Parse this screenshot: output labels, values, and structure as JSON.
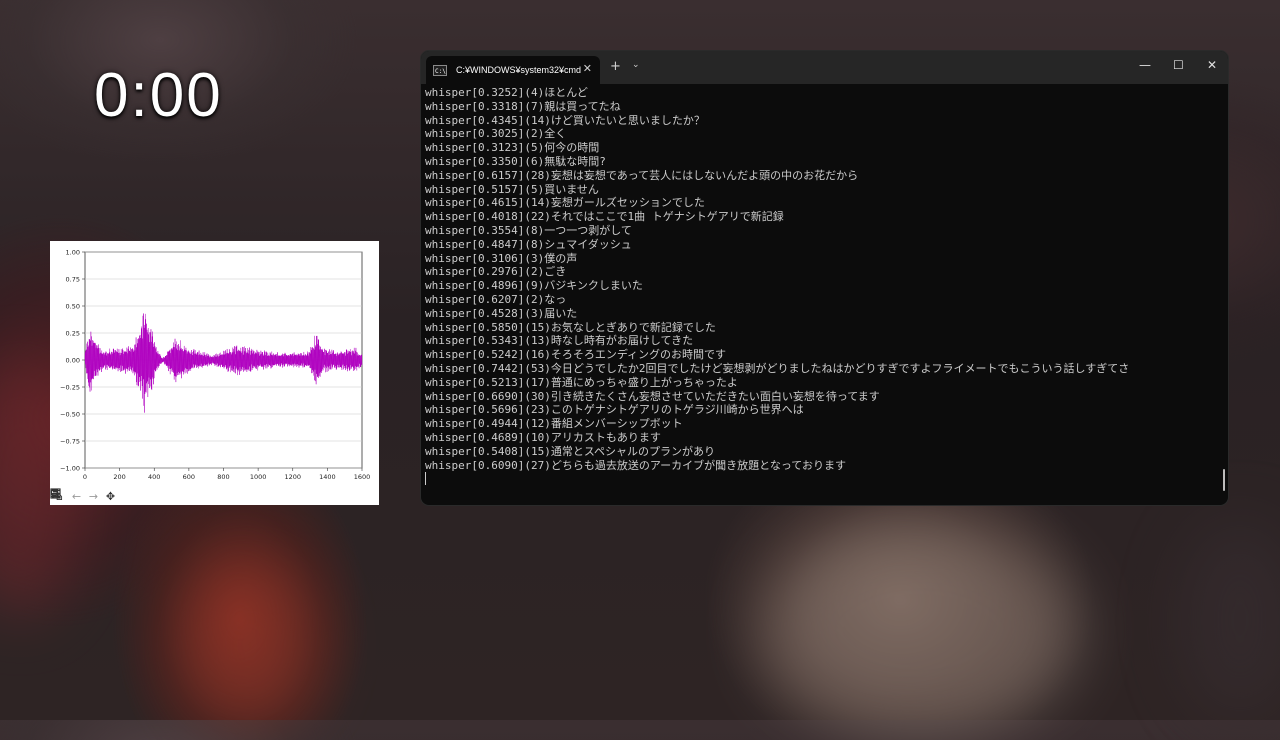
{
  "timer": "0:00",
  "terminal": {
    "tab_title": "C:¥WINDOWS¥system32¥cmd",
    "tab_icon_text": "C:\\",
    "new_tab_label": "+",
    "dropdown_label": "⌄",
    "minimize_label": "—",
    "maximize_label": "☐",
    "close_label": "✕",
    "tab_close_label": "✕",
    "lines": [
      "whisper[0.3252](4)ほとんど",
      "whisper[0.3318](7)親は買ってたね",
      "whisper[0.4345](14)けど買いたいと思いましたか？",
      "whisper[0.3025](2)全く",
      "whisper[0.3123](5)何今の時間",
      "whisper[0.3350](6)無駄な時間?",
      "whisper[0.6157](28)妄想は妄想であって芸人にはしないんだよ頭の中のお花だから",
      "whisper[0.5157](5)買いません",
      "whisper[0.4615](14)妄想ガールズセッションでした",
      "whisper[0.4018](22)それではここで1曲 トゲナシトゲアリで新記録",
      "whisper[0.3554](8)一つ一つ剥がして",
      "whisper[0.4847](8)シュマイダッシュ",
      "whisper[0.3106](3)僕の声",
      "whisper[0.2976](2)ごき",
      "whisper[0.4896](9)バジキンクしまいた",
      "whisper[0.6207](2)なっ",
      "whisper[0.4528](3)届いた",
      "whisper[0.5850](15)お気なしとぎありで新記録でした",
      "whisper[0.5343](13)時なし時有がお届けしてきた",
      "whisper[0.5242](16)そろそろエンディングのお時間です",
      "whisper[0.7442](53)今日どうでしたか2回目でしたけど妄想剥がどりましたねはかどりすぎですよフライメートでもこういう話しすぎてさ",
      "whisper[0.5213](17)普通にめっちゃ盛り上がっちゃったよ",
      "whisper[0.6690](30)引き続きたくさん妄想させていただきたい面白い妄想を待ってます",
      "whisper[0.5696](23)このトゲナシトゲアリのトゲラジ川崎から世界へは",
      "whisper[0.4944](12)番組メンバーシップボット",
      "whisper[0.4689](10)アリカストもあります",
      "whisper[0.5408](15)通常とスペシャルのプランがあり",
      "whisper[0.6090](27)どちらも過去放送のアーカイブが聞き放題となっております"
    ]
  },
  "plot": {
    "chart_data": {
      "type": "line",
      "title": "",
      "xlabel": "",
      "ylabel": "",
      "xlim": [
        0,
        1600
      ],
      "ylim": [
        -1.0,
        1.0
      ],
      "x_ticks": [
        "0",
        "200",
        "400",
        "600",
        "800",
        "1000",
        "1200",
        "1400",
        "1600"
      ],
      "y_ticks": [
        "1.00",
        "0.75",
        "0.50",
        "0.25",
        "0.00",
        "−0.25",
        "−0.50",
        "−0.75",
        "−1.00"
      ],
      "grid": "horizontal",
      "color": "#b000c0",
      "envelope": [
        {
          "x": 0,
          "amp": 0.08
        },
        {
          "x": 30,
          "amp": 0.38
        },
        {
          "x": 60,
          "amp": 0.2
        },
        {
          "x": 100,
          "amp": 0.1
        },
        {
          "x": 200,
          "amp": 0.12
        },
        {
          "x": 280,
          "amp": 0.15
        },
        {
          "x": 320,
          "amp": 0.35
        },
        {
          "x": 345,
          "amp": 0.53
        },
        {
          "x": 380,
          "amp": 0.35
        },
        {
          "x": 420,
          "amp": 0.1
        },
        {
          "x": 450,
          "amp": 0.02
        },
        {
          "x": 530,
          "amp": 0.24
        },
        {
          "x": 570,
          "amp": 0.15
        },
        {
          "x": 640,
          "amp": 0.1
        },
        {
          "x": 740,
          "amp": 0.05
        },
        {
          "x": 880,
          "amp": 0.15
        },
        {
          "x": 1000,
          "amp": 0.1
        },
        {
          "x": 1120,
          "amp": 0.07
        },
        {
          "x": 1290,
          "amp": 0.08
        },
        {
          "x": 1340,
          "amp": 0.28
        },
        {
          "x": 1380,
          "amp": 0.12
        },
        {
          "x": 1460,
          "amp": 0.09
        },
        {
          "x": 1560,
          "amp": 0.12
        },
        {
          "x": 1600,
          "amp": 0.06
        }
      ]
    },
    "toolbar": [
      "home-icon",
      "back-icon",
      "forward-icon",
      "pan-icon",
      "zoom-icon",
      "configure-icon",
      "save-icon"
    ]
  }
}
